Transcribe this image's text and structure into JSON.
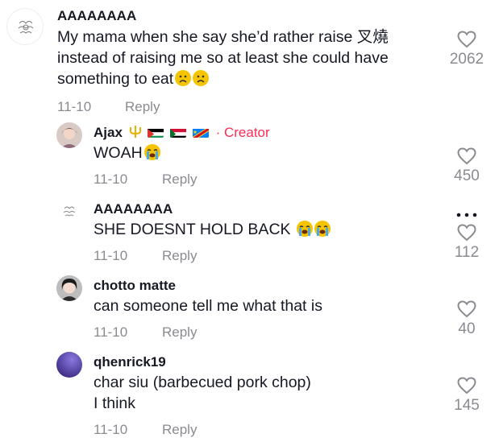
{
  "comments": [
    {
      "username": "AAAAAAAA",
      "text_lines": [
        "My mama when she say she’d rather raise 叉燒",
        "instead of raising me so at least she could have",
        "something to eat"
      ],
      "date": "11-10",
      "reply_label": "Reply",
      "likes": "2062",
      "emoji": [
        "frowning-face",
        "frowning-face"
      ]
    },
    {
      "username": "Ajax",
      "badge": "· Creator",
      "text_lines": [
        "WOAH"
      ],
      "emoji": [
        "loudly-crying-face"
      ],
      "date": "11-10",
      "reply_label": "Reply",
      "likes": "450"
    },
    {
      "username": "AAAAAAAA",
      "text_lines": [
        "SHE DOESNT HOLD BACK"
      ],
      "emoji": [
        "loudly-crying-face",
        "loudly-crying-face"
      ],
      "date": "11-10",
      "reply_label": "Reply",
      "likes": "112"
    },
    {
      "username": "chotto matte",
      "text_lines": [
        "can someone tell me what that is"
      ],
      "date": "11-10",
      "reply_label": "Reply",
      "likes": "40"
    },
    {
      "username": "qhenrick19",
      "text_lines": [
        "char siu (barbecued pork chop)",
        "I think"
      ],
      "date": "11-10",
      "reply_label": "Reply",
      "likes": "145"
    }
  ],
  "colors": {
    "creator": "#fe2c55",
    "secondary": "#8a8b91",
    "text": "#161823"
  },
  "icons": [
    "heart-outline-icon",
    "more-options-icon",
    "trident-icon"
  ]
}
